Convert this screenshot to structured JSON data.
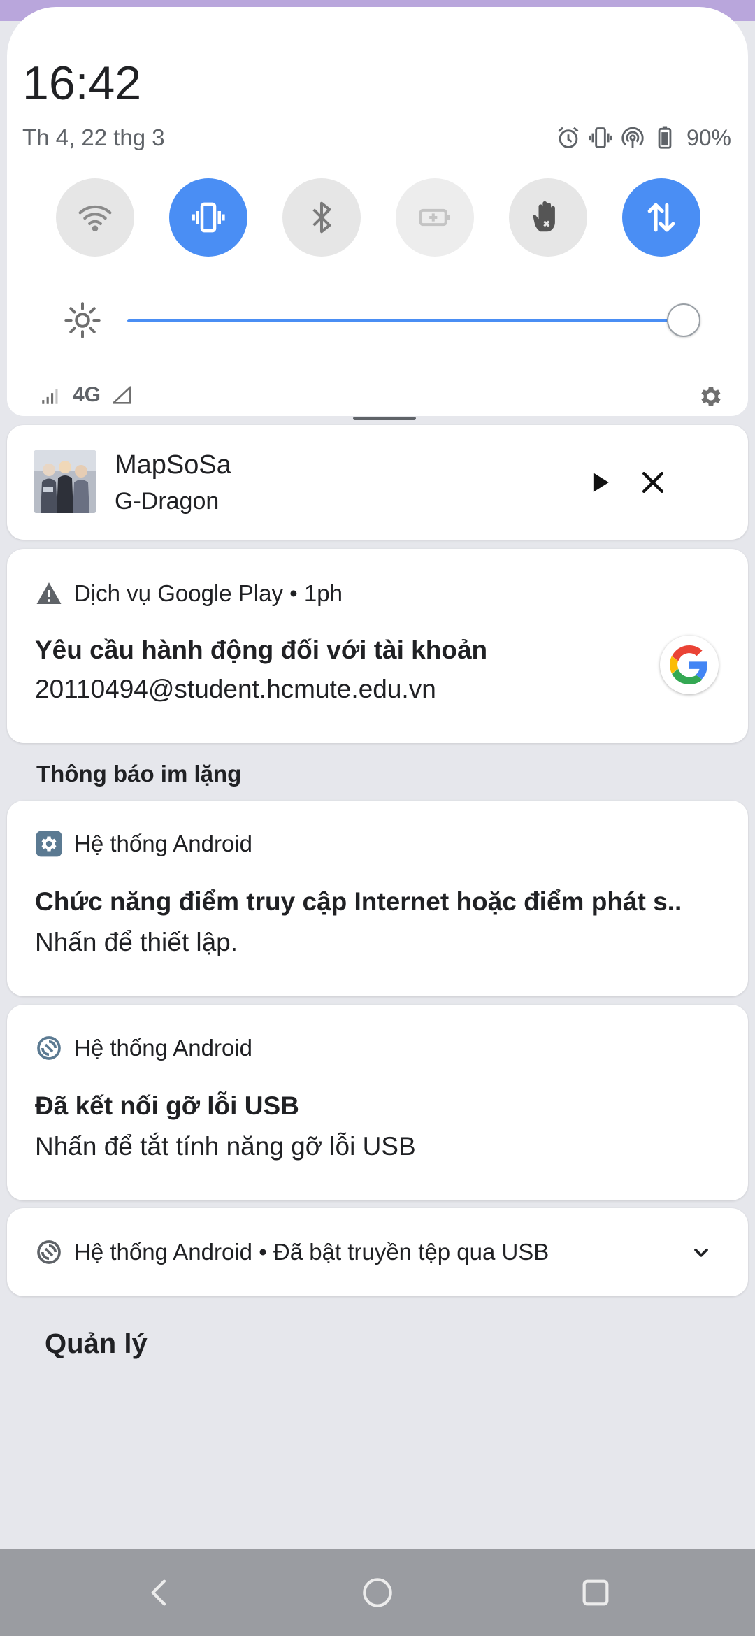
{
  "status": {
    "time": "16:42",
    "date": "Th 4, 22 thg 3",
    "battery_percent": "90%",
    "icons": [
      "alarm-icon",
      "vibrate-icon",
      "hotspot-icon",
      "battery-icon"
    ]
  },
  "quick_settings": {
    "tiles": [
      {
        "name": "wifi-icon",
        "active": false
      },
      {
        "name": "vibrate-icon",
        "active": true
      },
      {
        "name": "bluetooth-icon",
        "active": false
      },
      {
        "name": "battery-saver-icon",
        "active": false,
        "disabled": true
      },
      {
        "name": "do-not-disturb-hand-icon",
        "active": false
      },
      {
        "name": "mobile-data-icon",
        "active": true
      }
    ],
    "brightness_level": 1.0,
    "network_type": "4G"
  },
  "media": {
    "title": "MapSoSa",
    "artist": "G-Dragon"
  },
  "notifications": {
    "google_play": {
      "app": "Dịch vụ Google Play • 1ph",
      "title": "Yêu cầu hành động đối với tài khoản",
      "text": "20110494@student.hcmute.edu.vn"
    },
    "silent_section_label": "Thông báo im lặng",
    "hotspot": {
      "app": "Hệ thống Android",
      "title": "Chức năng điểm truy cập Internet hoặc điểm phát s..",
      "text": "Nhấn để thiết lập."
    },
    "usb_debug": {
      "app": "Hệ thống Android",
      "title": "Đã kết nối gỡ lỗi USB",
      "text": "Nhấn để tắt tính năng gỡ lỗi USB"
    },
    "usb_file": {
      "summary": "Hệ thống Android • Đã bật truyền tệp qua USB"
    }
  },
  "manage_label": "Quản lý",
  "colors": {
    "accent": "#4a8ef4",
    "background": "#e6e7ec",
    "nav_bar": "#9a9ca1"
  }
}
